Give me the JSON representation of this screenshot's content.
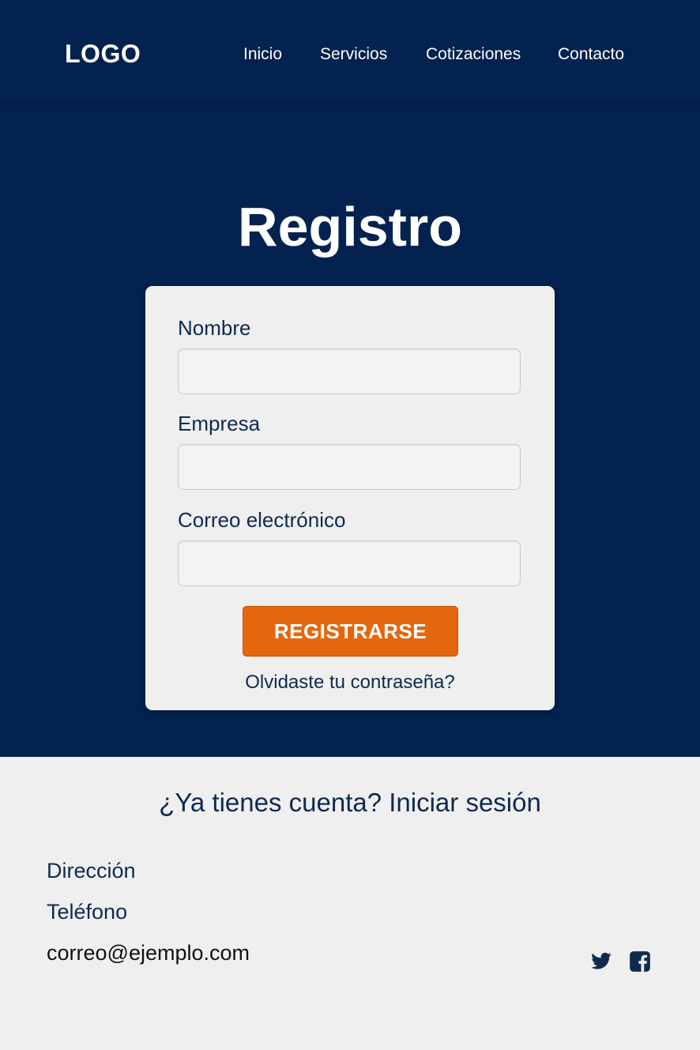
{
  "header": {
    "logo": "LOGO",
    "nav": [
      "Inicio",
      "Servicios",
      "Cotizaciones",
      "Contacto"
    ]
  },
  "hero": {
    "title": "Registro"
  },
  "form": {
    "fields": [
      {
        "label": "Nombre",
        "value": ""
      },
      {
        "label": "Empresa",
        "value": ""
      },
      {
        "label": "Correo electrónico",
        "value": ""
      }
    ],
    "submit_label": "REGISTRARSE",
    "forgot_link": "Olvidaste tu contraseña?"
  },
  "footer": {
    "login_prompt": "¿Ya tienes cuenta? Iniciar sesión",
    "address": "Dirección",
    "phone": "Teléfono",
    "email": "correo@ejemplo.com",
    "social": [
      "twitter-icon",
      "facebook-icon"
    ]
  },
  "colors": {
    "navy": "#03224f",
    "accent": "#e5660c",
    "text_dark": "#0f2a4f",
    "background_light": "#efefef"
  }
}
